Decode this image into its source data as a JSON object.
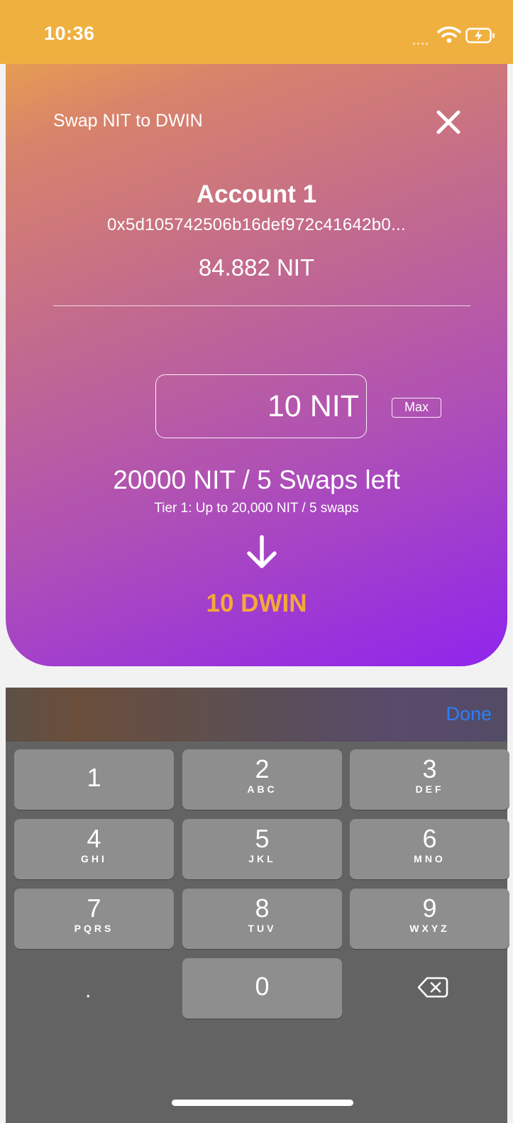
{
  "status_bar": {
    "time": "10:36"
  },
  "header": {
    "title": "Swap NIT to DWIN",
    "close_icon": "close-icon"
  },
  "account": {
    "name": "Account 1",
    "address": "0x5d105742506b16def972c41642b0...",
    "balance": "84.882 NIT"
  },
  "swap": {
    "amount_value": "10 NIT",
    "max_label": "Max",
    "limit_text": "20000 NIT / 5 Swaps left",
    "tier_text": "Tier 1: Up to 20,000 NIT / 5 swaps",
    "arrow_icon": "arrow-down-icon",
    "result_text": "10 DWIN"
  },
  "keyboard": {
    "done_label": "Done",
    "keys": [
      {
        "digit": "1",
        "letters": ""
      },
      {
        "digit": "2",
        "letters": "ABC"
      },
      {
        "digit": "3",
        "letters": "DEF"
      },
      {
        "digit": "4",
        "letters": "GHI"
      },
      {
        "digit": "5",
        "letters": "JKL"
      },
      {
        "digit": "6",
        "letters": "MNO"
      },
      {
        "digit": "7",
        "letters": "PQRS"
      },
      {
        "digit": "8",
        "letters": "TUV"
      },
      {
        "digit": "9",
        "letters": "WXYZ"
      },
      {
        "digit": ".",
        "letters": ""
      },
      {
        "digit": "0",
        "letters": ""
      }
    ],
    "backspace_icon": "backspace-icon"
  },
  "colors": {
    "status_bar": "#f0b03f",
    "gradient_end": "#8f25ed",
    "result_accent": "#f4a93a",
    "done_blue": "#2d7ef7",
    "key_bg": "#8e8e8e",
    "keyboard_bg": "#636363"
  }
}
